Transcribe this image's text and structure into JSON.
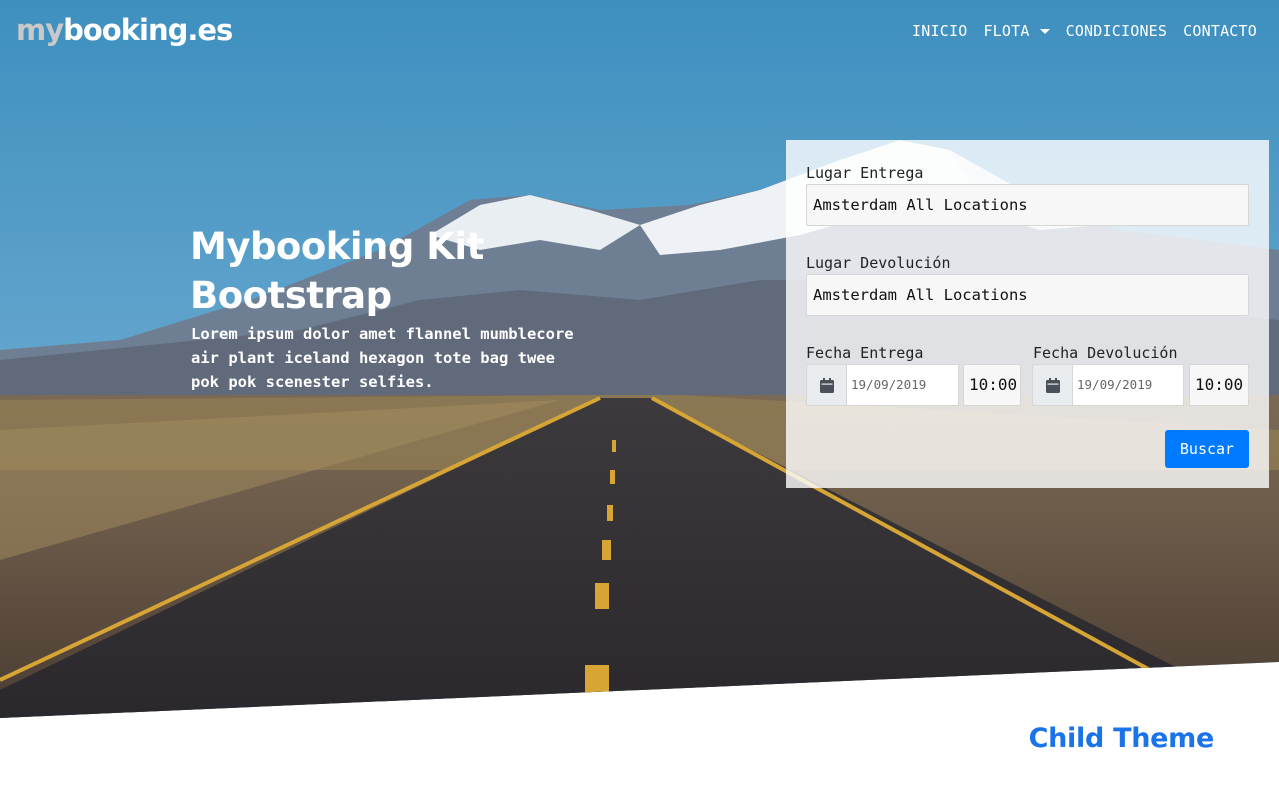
{
  "brand": {
    "prefix": "my",
    "rest": "booking.es"
  },
  "nav": {
    "items": [
      {
        "label": "INICIO"
      },
      {
        "label": "FLOTA"
      },
      {
        "label": "CONDICIONES"
      },
      {
        "label": "CONTACTO"
      }
    ]
  },
  "hero": {
    "title": "Mybooking Kit Bootstrap",
    "text": "Lorem ipsum dolor amet flannel mumblecore air plant iceland hexagon tote bag twee pok pok scenester selfies."
  },
  "booking": {
    "pickup_place_label": "Lugar Entrega",
    "pickup_place_value": "Amsterdam All Locations",
    "return_place_label": "Lugar Devolución",
    "return_place_value": "Amsterdam All Locations",
    "pickup_date_label": "Fecha Entrega",
    "pickup_date_value": "19/09/2019",
    "pickup_time_value": "10:00",
    "return_date_label": "Fecha Devolución",
    "return_date_value": "19/09/2019",
    "return_time_value": "10:00",
    "search_label": "Buscar"
  },
  "footer_heading": "Child Theme",
  "colors": {
    "accent": "#007bff",
    "heading_link": "#1a73e8"
  }
}
